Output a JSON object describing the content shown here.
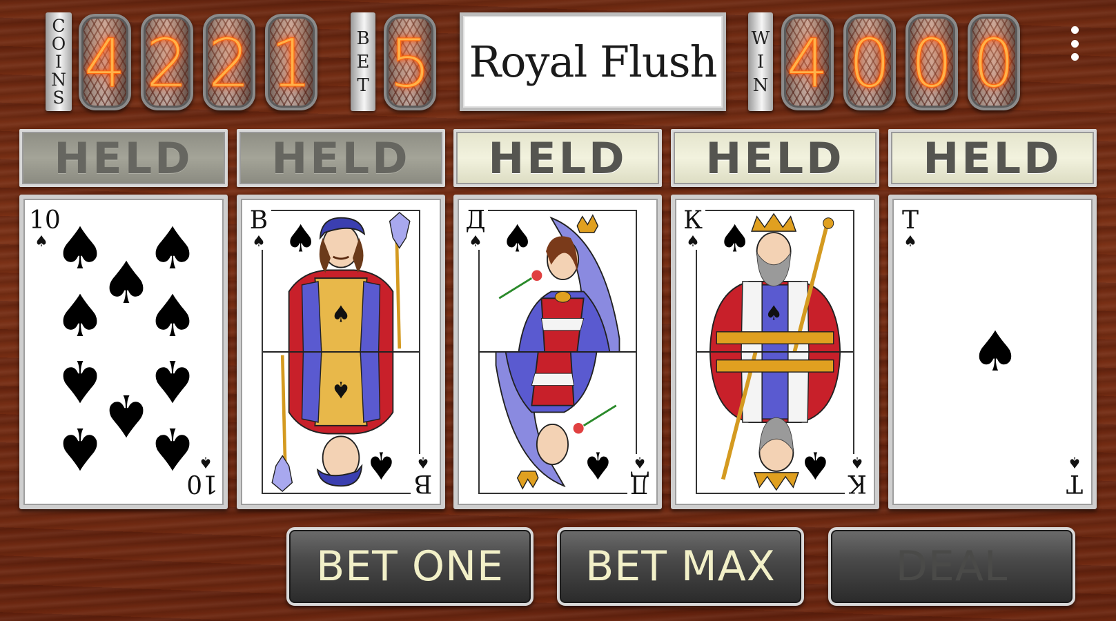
{
  "labels": {
    "coins": [
      "C",
      "O",
      "I",
      "N",
      "S"
    ],
    "bet": [
      "B",
      "E",
      "T"
    ],
    "win": [
      "W",
      "I",
      "N"
    ]
  },
  "coins_digits": [
    "4",
    "2",
    "2",
    "1"
  ],
  "bet_digits": [
    "5"
  ],
  "win_digits": [
    "4",
    "0",
    "0",
    "0"
  ],
  "hand_name": "Royal Flush",
  "held": [
    {
      "label": "HELD",
      "state": "off"
    },
    {
      "label": "HELD",
      "state": "off"
    },
    {
      "label": "HELD",
      "state": "on"
    },
    {
      "label": "HELD",
      "state": "on"
    },
    {
      "label": "HELD",
      "state": "on"
    }
  ],
  "cards": [
    {
      "rank": "10",
      "suit": "♠",
      "kind": "pips"
    },
    {
      "rank": "В",
      "suit": "♠",
      "kind": "jack"
    },
    {
      "rank": "Д",
      "suit": "♠",
      "kind": "queen"
    },
    {
      "rank": "К",
      "suit": "♠",
      "kind": "king"
    },
    {
      "rank": "Т",
      "suit": "♠",
      "kind": "ace"
    }
  ],
  "buttons": {
    "bet_one": "BET ONE",
    "bet_max": "BET MAX",
    "deal": "DEAL"
  },
  "colors": {
    "felt_wood": "#7b3116",
    "tube_digit": "#ffb24a",
    "button_text": "#f2f0c8",
    "held_on": "#f2f2de",
    "held_off": "#a4a498"
  },
  "icons": {
    "menu": "overflow-menu-icon"
  }
}
